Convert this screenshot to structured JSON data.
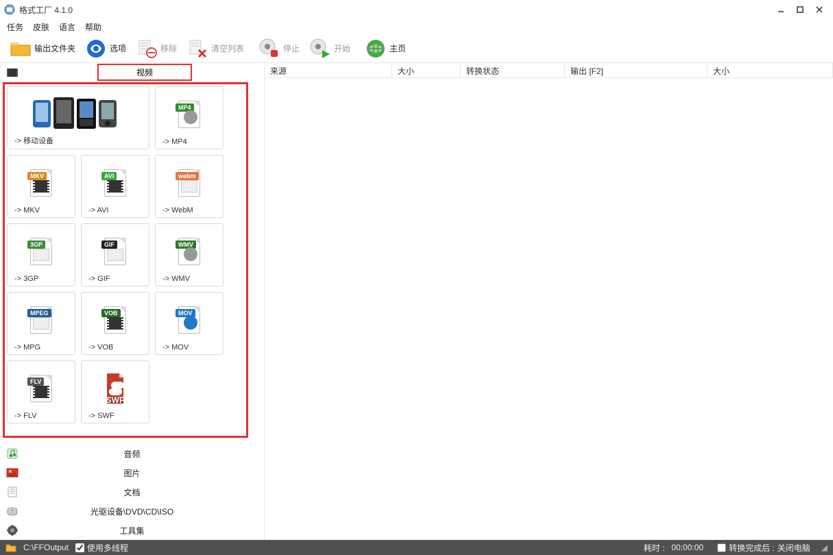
{
  "title": "格式工厂 4.1.0",
  "menu": {
    "task": "任务",
    "skin": "皮肤",
    "lang": "语言",
    "help": "帮助"
  },
  "toolbar": {
    "output_folder": "输出文件夹",
    "options": "选项",
    "remove": "移除",
    "clear": "清空列表",
    "stop": "停止",
    "start": "开始",
    "home": "主页"
  },
  "categories": {
    "video": "视频",
    "audio": "音频",
    "image": "图片",
    "document": "文档",
    "rom": "光驱设备\\DVD\\CD\\ISO",
    "toolbox": "工具集"
  },
  "tiles": [
    {
      "id": "mobile",
      "label": "-> 移动设备",
      "wide": true,
      "badge": "MOBILE",
      "color": "#888"
    },
    {
      "id": "mp4",
      "label": "-> MP4",
      "badge": "MP4",
      "color": "#2e8b2e"
    },
    {
      "id": "mkv",
      "label": "-> MKV",
      "badge": "MKV",
      "color": "#d98a1f"
    },
    {
      "id": "avi",
      "label": "-> AVI",
      "badge": "AVI",
      "color": "#3da83d"
    },
    {
      "id": "webm",
      "label": "-> WebM",
      "badge": "webm",
      "color": "#e2774a"
    },
    {
      "id": "3gp",
      "label": "-> 3GP",
      "badge": "3GP",
      "color": "#3d8a3d"
    },
    {
      "id": "gif",
      "label": "-> GIF",
      "badge": "GIF",
      "color": "#222"
    },
    {
      "id": "wmv",
      "label": "-> WMV",
      "badge": "WMV",
      "color": "#2b7a2b"
    },
    {
      "id": "mpg",
      "label": "-> MPG",
      "badge": "MPEG",
      "color": "#245a9a"
    },
    {
      "id": "vob",
      "label": "-> VOB",
      "badge": "VOB",
      "color": "#2a6a2a"
    },
    {
      "id": "mov",
      "label": "-> MOV",
      "badge": "MOV",
      "color": "#1f78c8"
    },
    {
      "id": "flv",
      "label": "-> FLV",
      "badge": "FLV",
      "color": "#555"
    },
    {
      "id": "swf",
      "label": "-> SWF",
      "badge": "SWF",
      "color": "#c63a2e"
    }
  ],
  "list_headers": {
    "source": "来源",
    "size": "大小",
    "state": "转换状态",
    "output": "输出 [F2]",
    "size2": "大小"
  },
  "status": {
    "output_path": "C:\\FFOutput",
    "multithread": "使用多线程",
    "elapsed_label": "耗时 : ",
    "elapsed_value": "00:00:00",
    "after_label": "转换完成后 : ",
    "after_value": "关闭电脑"
  }
}
